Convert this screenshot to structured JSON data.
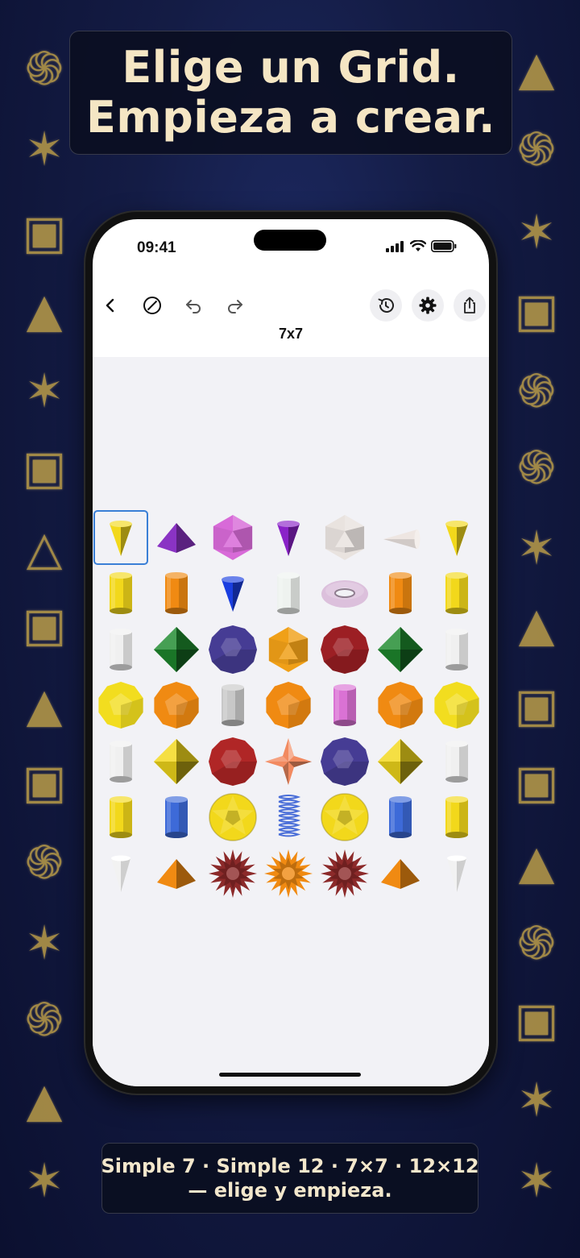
{
  "headline": {
    "line1": "Elige un Grid.",
    "line2": "Empieza a crear."
  },
  "status_bar": {
    "time": "09:41",
    "icons": [
      "signal-icon",
      "wifi-icon",
      "battery-icon"
    ]
  },
  "toolbar": {
    "left_buttons": [
      "back-icon",
      "clear-icon",
      "undo-icon",
      "redo-icon"
    ],
    "right_buttons": [
      "history-icon",
      "settings-icon",
      "share-icon"
    ]
  },
  "grid_title": "7x7",
  "grid": {
    "rows": 7,
    "cols": 7,
    "selected_cell": [
      0,
      0
    ],
    "cells": [
      [
        {
          "shape": "cone",
          "color": "#f2d81b"
        },
        {
          "shape": "pyramid",
          "color": "#8a33c4"
        },
        {
          "shape": "icosahedron",
          "color": "#d86ad8"
        },
        {
          "shape": "cone",
          "color": "#8a22c8"
        },
        {
          "shape": "icosahedron",
          "color": "#e9e3df"
        },
        {
          "shape": "cone-side",
          "color": "#eee6e2"
        },
        {
          "shape": "cone",
          "color": "#f2d81b"
        }
      ],
      [
        {
          "shape": "cylinder",
          "color": "#f2d81b"
        },
        {
          "shape": "cylinder",
          "color": "#f08a12"
        },
        {
          "shape": "cone",
          "color": "#1a3ee0"
        },
        {
          "shape": "cylinder",
          "color": "#eef2ef"
        },
        {
          "shape": "torus",
          "color": "#dcc0dc"
        },
        {
          "shape": "cylinder",
          "color": "#f08a12"
        },
        {
          "shape": "cylinder",
          "color": "#f2d81b"
        }
      ],
      [
        {
          "shape": "cylinder",
          "color": "#f0f0f0"
        },
        {
          "shape": "octahedron",
          "color": "#1e8a2e"
        },
        {
          "shape": "sphere-poly",
          "color": "#463c94"
        },
        {
          "shape": "icosahedron",
          "color": "#f0a018"
        },
        {
          "shape": "sphere-poly",
          "color": "#9c1f24"
        },
        {
          "shape": "octahedron",
          "color": "#1e8a2e"
        },
        {
          "shape": "cylinder",
          "color": "#f0f0f0"
        }
      ],
      [
        {
          "shape": "dodecahedron",
          "color": "#f2dd1f"
        },
        {
          "shape": "dodecahedron",
          "color": "#f08a12"
        },
        {
          "shape": "cylinder",
          "color": "#c8c8c8"
        },
        {
          "shape": "dodecahedron",
          "color": "#f08a12"
        },
        {
          "shape": "cylinder",
          "color": "#da72d4"
        },
        {
          "shape": "dodecahedron",
          "color": "#f08a12"
        },
        {
          "shape": "dodecahedron",
          "color": "#f2dd1f"
        }
      ],
      [
        {
          "shape": "cylinder",
          "color": "#f0f0f0"
        },
        {
          "shape": "octahedron",
          "color": "#f2d81b"
        },
        {
          "shape": "sphere-poly",
          "color": "#b02626"
        },
        {
          "shape": "star-octa",
          "color": "#f28a60"
        },
        {
          "shape": "sphere-poly",
          "color": "#463c94"
        },
        {
          "shape": "octahedron",
          "color": "#f2d81b"
        },
        {
          "shape": "cylinder",
          "color": "#f0f0f0"
        }
      ],
      [
        {
          "shape": "cylinder",
          "color": "#f2d81b"
        },
        {
          "shape": "cylinder",
          "color": "#3d6ad8"
        },
        {
          "shape": "star-dodeca",
          "color": "#f2d81b"
        },
        {
          "shape": "spring",
          "color": "#4a6ed8"
        },
        {
          "shape": "star-dodeca",
          "color": "#f2d81b"
        },
        {
          "shape": "cylinder",
          "color": "#3d6ad8"
        },
        {
          "shape": "cylinder",
          "color": "#f2d81b"
        }
      ],
      [
        {
          "shape": "cone-down",
          "color": "#f2f2f2"
        },
        {
          "shape": "pyramid",
          "color": "#f08a12"
        },
        {
          "shape": "spiky",
          "color": "#8c2a2a"
        },
        {
          "shape": "spiky",
          "color": "#f08a12"
        },
        {
          "shape": "spiky",
          "color": "#8c2a2a"
        },
        {
          "shape": "pyramid",
          "color": "#f08a12"
        },
        {
          "shape": "cone-down",
          "color": "#f2f2f2"
        }
      ]
    ]
  },
  "caption": {
    "line1": "Simple 7 · Simple 12 · 7×7 · 12×12",
    "line2": "— elige y empieza."
  },
  "background_symbols": {
    "left_column": [
      "spiral",
      "star",
      "cube",
      "pyramid",
      "star",
      "cube",
      "triangle",
      "cube",
      "pyramid",
      "cube",
      "spiral",
      "star",
      "spiral",
      "pyramid",
      "star"
    ],
    "right_column": [
      "pyramid",
      "spiral",
      "star",
      "cube",
      "spiral",
      "spiral",
      "star",
      "pyramid",
      "cube",
      "cube",
      "pyramid",
      "spiral",
      "cube",
      "star",
      "star"
    ]
  }
}
